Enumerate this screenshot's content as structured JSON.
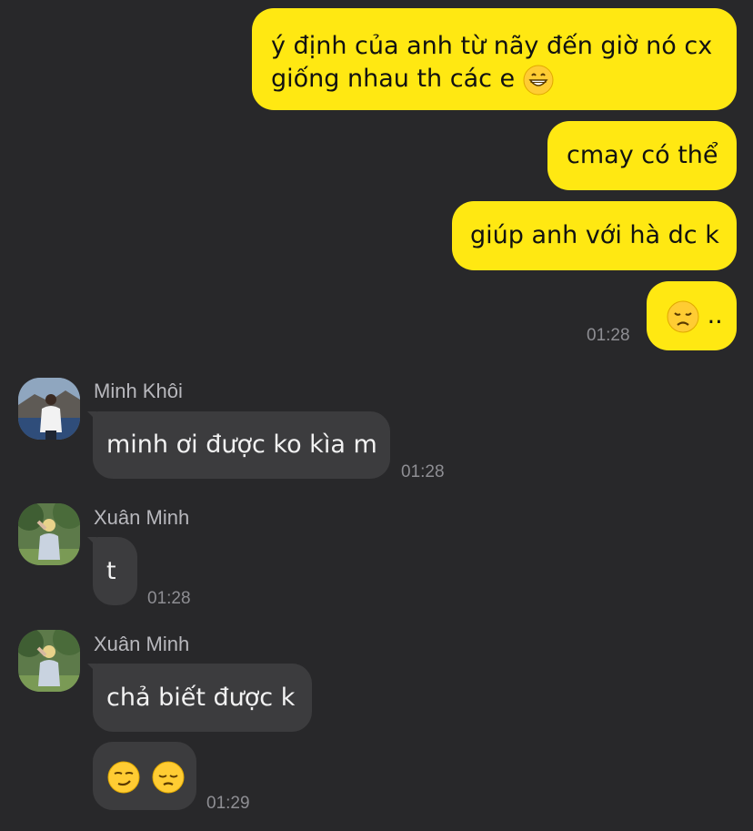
{
  "conversation": {
    "outgoing": [
      {
        "text_line1": "ý định của anh từ nãy đến giờ nó cx",
        "text_line2": "giống nhau th các e"
      },
      {
        "text": "cmay có thể"
      },
      {
        "text": "giúp anh với hà dc k"
      },
      {
        "text": "..",
        "time": "01:28"
      }
    ],
    "incoming": [
      {
        "sender": "Minh Khôi",
        "text": "minh ơi được ko kìa m",
        "time": "01:28"
      },
      {
        "sender": "Xuân Minh",
        "text": "t",
        "time": "01:28"
      },
      {
        "sender": "Xuân Minh",
        "text": "chả biết được k",
        "time": ""
      },
      {
        "text": "",
        "time": "01:29"
      }
    ]
  },
  "icons": {
    "grin": "grinning-face-emoji",
    "disappointed": "disappointed-face-emoji",
    "smirk": "smirking-face-emoji",
    "pensive": "pensive-face-emoji"
  },
  "colors": {
    "background": "#28282a",
    "outgoing_bubble": "#ffe812",
    "incoming_bubble": "#3c3c3e",
    "timestamp": "#8e8e93"
  }
}
